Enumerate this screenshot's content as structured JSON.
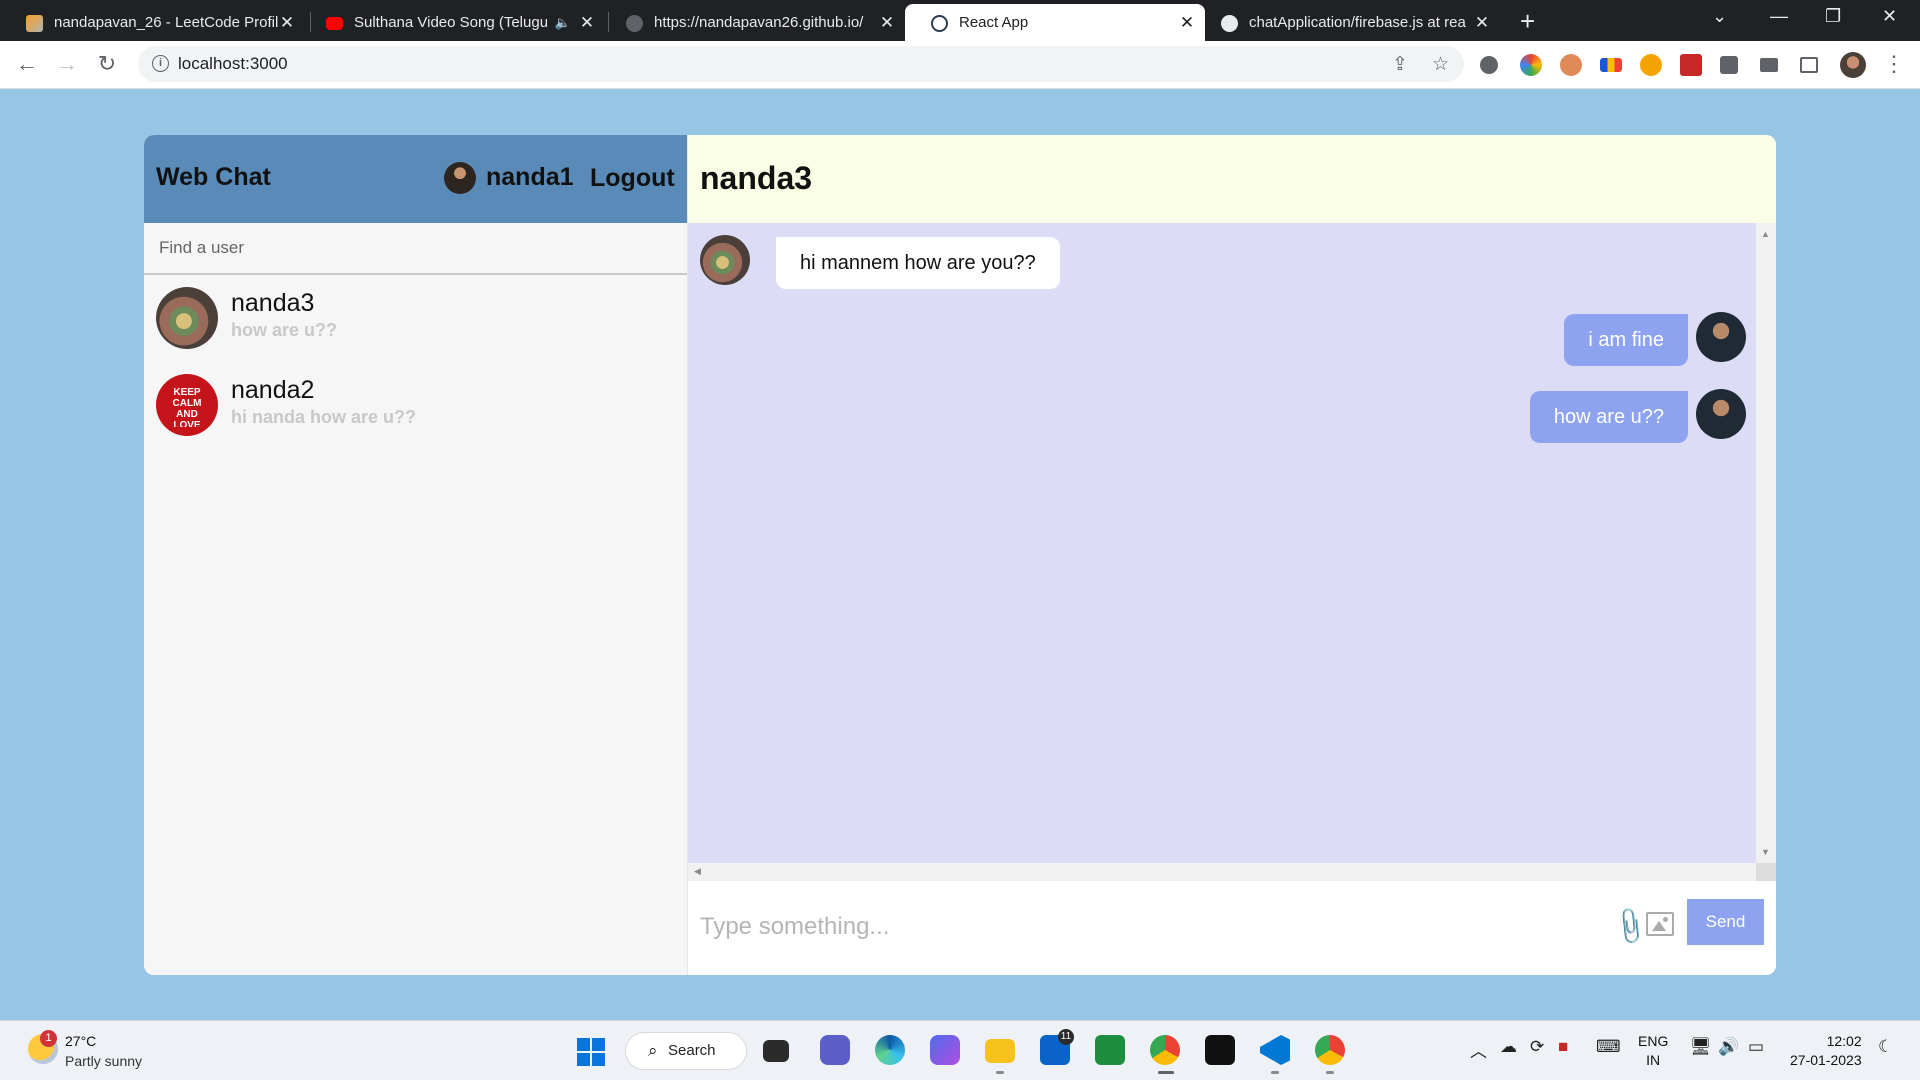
{
  "browser": {
    "tabs": [
      {
        "label": "nandapavan_26 - LeetCode Profil",
        "icon": "leetcode-icon"
      },
      {
        "label": "Sulthana Video Song (Telugu",
        "icon": "youtube-icon"
      },
      {
        "label": "https://nandapavan26.github.io/",
        "icon": "globe-icon"
      },
      {
        "label": "React App",
        "icon": "react-icon"
      },
      {
        "label": "chatApplication/firebase.js at rea",
        "icon": "github-icon"
      }
    ],
    "address": "localhost:3000"
  },
  "app": {
    "brand": "Web Chat",
    "current_user": "nanda1",
    "logout_label": "Logout",
    "search_placeholder": "Find a user",
    "chats": [
      {
        "name": "nanda3",
        "last_message": "how are u??"
      },
      {
        "name": "nanda2",
        "last_message": "hi nanda how are u??"
      }
    ],
    "nanda2_avatar_text": "KEEP CALM AND LOVE CODING",
    "active_chat": "nanda3",
    "messages": [
      {
        "text": "hi mannem how are you??",
        "owner": false
      },
      {
        "text": "i am fine",
        "owner": true
      },
      {
        "text": "how are u??",
        "owner": true
      }
    ],
    "composer_placeholder": "Type something...",
    "send_label": "Send",
    "colors": {
      "sidebar_header": "#5a8ab7",
      "chat_header": "#fbfee6",
      "messages_bg": "#dddcf7",
      "accent": "#8da3ef",
      "page_bg": "#96c5e5"
    }
  },
  "taskbar": {
    "temperature": "27°C",
    "condition": "Partly sunny",
    "weather_badge": "1",
    "search_label": "Search",
    "mail_badge": "11",
    "lang_top": "ENG",
    "lang_bottom": "IN",
    "time": "12:02",
    "date": "27-01-2023"
  }
}
